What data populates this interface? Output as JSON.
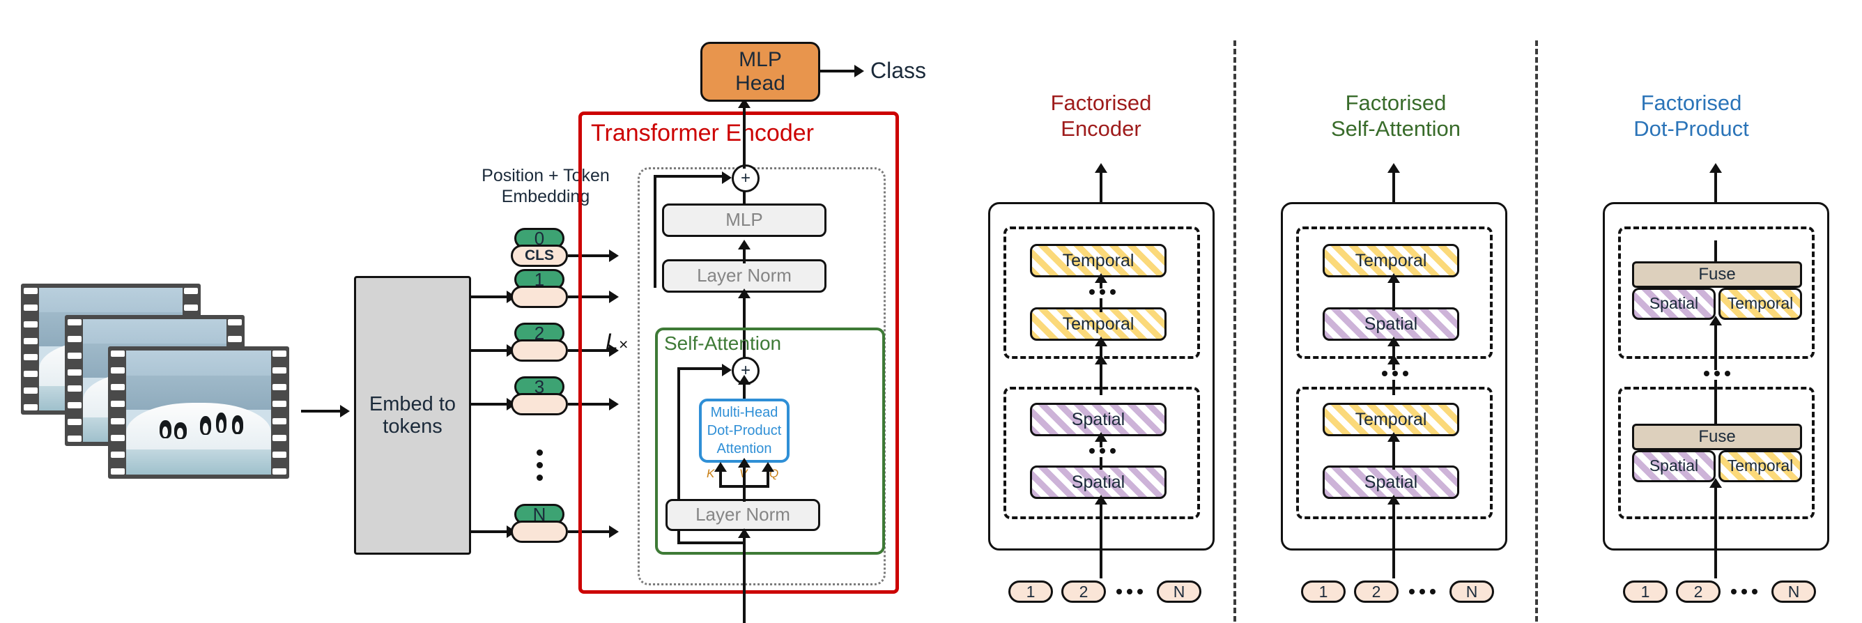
{
  "diagram": {
    "title_absent": true,
    "left_panel": {
      "embed_block_label": "Embed to\ntokens",
      "embed_line1": "Embed to",
      "embed_line2": "tokens",
      "pos_embed_label_line1": "Position + Token",
      "pos_embed_label_line2": "Embedding",
      "position_tokens": [
        "0",
        "1",
        "2",
        "3",
        "N"
      ],
      "cls_token_label": "CLS",
      "vertical_ellipsis": "⋮",
      "mlp_head_label_line1": "MLP",
      "mlp_head_label_line2": "Head",
      "class_output_label": "Class",
      "encoder_title": "Transformer Encoder",
      "repeat_label": "L×",
      "repeat_symbol": "L",
      "repeat_times": "×",
      "mlp_label": "MLP",
      "layer_norm_top_label": "Layer Norm",
      "layer_norm_bottom_label": "Layer Norm",
      "self_attention_label": "Self-Attention",
      "attention_box_line1": "Multi-Head",
      "attention_box_line2": "Dot-Product",
      "attention_box_line3": "Attention",
      "qkv_labels": [
        "K",
        "V",
        "Q"
      ],
      "residual_symbol": "+"
    },
    "variants": [
      {
        "title_line1": "Factorised",
        "title_line2": "Encoder",
        "title_color": "#9e1b1b",
        "groups": [
          {
            "blocks": [
              "Temporal",
              "Temporal"
            ],
            "kind": "temporal",
            "inner_ellipsis": "⋯"
          },
          {
            "blocks": [
              "Spatial",
              "Spatial"
            ],
            "kind": "spatial",
            "inner_ellipsis": "⋯"
          }
        ],
        "between_groups_ellipsis": "",
        "input_tokens": [
          "1",
          "2",
          "N"
        ],
        "input_ellipsis": "⋯"
      },
      {
        "title_line1": "Factorised",
        "title_line2": "Self-Attention",
        "title_color": "#386b2a",
        "groups": [
          {
            "blocks": [
              "Temporal",
              "Spatial"
            ],
            "kind": "mixed",
            "inner_ellipsis": ""
          },
          {
            "blocks": [
              "Temporal",
              "Spatial"
            ],
            "kind": "mixed",
            "inner_ellipsis": ""
          }
        ],
        "between_groups_ellipsis": "⋯",
        "input_tokens": [
          "1",
          "2",
          "N"
        ],
        "input_ellipsis": "⋯"
      },
      {
        "title_line1": "Factorised",
        "title_line2": "Dot-Product",
        "title_color": "#2b74b8",
        "groups": [
          {
            "blocks": [
              "Fuse",
              "Spatial",
              "Temporal"
            ],
            "kind": "fuse",
            "inner_ellipsis": ""
          },
          {
            "blocks": [
              "Fuse",
              "Spatial",
              "Temporal"
            ],
            "kind": "fuse",
            "inner_ellipsis": ""
          }
        ],
        "between_groups_ellipsis": "⋯",
        "input_tokens": [
          "1",
          "2",
          "N"
        ],
        "input_ellipsis": "⋯"
      }
    ],
    "colors": {
      "encoder_red": "#cc0000",
      "self_attention_green": "#3e7a36",
      "attention_blue": "#2f8fd6",
      "mlp_head_orange": "#e8954d",
      "position_token_green": "#3da373",
      "token_pink": "#fae5d7",
      "fuse_tan": "#ddd0bd",
      "box_gray": "#f0f0f0",
      "box_gray_text": "#858585",
      "qkv_orange": "#c87e14"
    }
  }
}
